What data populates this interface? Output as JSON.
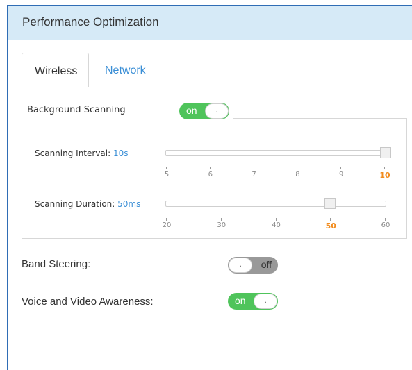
{
  "panel": {
    "title": "Performance Optimization"
  },
  "tabs": [
    {
      "label": "Wireless",
      "active": true
    },
    {
      "label": "Network",
      "active": false
    }
  ],
  "background_scanning": {
    "label": "Background Scanning",
    "toggle": {
      "state": "on",
      "label": "on",
      "knob": "."
    }
  },
  "scanning_interval": {
    "label": "Scanning Interval: ",
    "value": "10",
    "unit": "s",
    "ticks": [
      "5",
      "6",
      "7",
      "8",
      "9",
      "10"
    ],
    "selected": "10",
    "min": 5,
    "max": 10,
    "current": 10
  },
  "scanning_duration": {
    "label": "Scanning Duration: ",
    "value": "50",
    "unit": "ms",
    "ticks": [
      "20",
      "30",
      "40",
      "50",
      "60"
    ],
    "selected": "50",
    "min": 20,
    "max": 60,
    "current": 50
  },
  "band_steering": {
    "label": "Band Steering:",
    "toggle": {
      "state": "off",
      "label": "off",
      "knob": "."
    }
  },
  "voice_video": {
    "label": "Voice and Video Awareness:",
    "toggle": {
      "state": "on",
      "label": "on",
      "knob": "."
    }
  },
  "colors": {
    "accent": "#3b8fd6",
    "toggle_on": "#4fc45b",
    "selected_tick": "#f28c1e",
    "header_bg": "#d6eaf7"
  }
}
